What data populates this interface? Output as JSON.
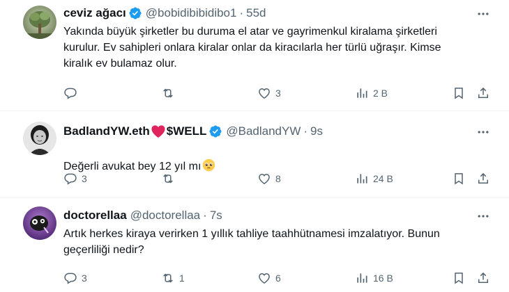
{
  "tweets": [
    {
      "display_name": "ceviz ağacı",
      "handle": "@bobidibibidibo1",
      "separator": "·",
      "time": "55d",
      "text": "Yakında büyük şirketler bu duruma el atar ve gayrimenkul kiralama şirketleri\nkurulur. Ev sahipleri onlara kiralar onlar da kiracılarla her türlü uğraşır. Kimse\nkiralık ev bulamaz olur.",
      "replies": "",
      "reposts": "",
      "likes": "3",
      "views": "2 B"
    },
    {
      "display_name": "BadlandYW.eth",
      "display_name_suffix": "$WELL",
      "handle": "@BadlandYW",
      "separator": "·",
      "time": "9s",
      "text": "Değerli avukat bey 12 yıl mı",
      "replies": "3",
      "reposts": "",
      "likes": "8",
      "views": "24 B"
    },
    {
      "display_name": "doctorellaa",
      "handle": "@doctorellaa",
      "separator": "·",
      "time": "7s",
      "text": "Artık herkes kiraya verirken 1 yıllık tahliye taahhütnamesi imzalatıyor. Bunun\ngeçerliliği nedir?",
      "replies": "3",
      "reposts": "1",
      "likes": "6",
      "views": "16 B"
    }
  ],
  "colors": {
    "text": "#0f1419",
    "muted": "#536471",
    "verified": "#1d9bf0",
    "heart": "#e0245e",
    "divider": "#eff3f4"
  },
  "icons": {
    "reply": "reply-icon",
    "repost": "repost-icon",
    "like": "like-icon",
    "views": "views-icon",
    "bookmark": "bookmark-icon",
    "share": "share-icon",
    "more": "more-icon",
    "verified": "verified-icon"
  }
}
